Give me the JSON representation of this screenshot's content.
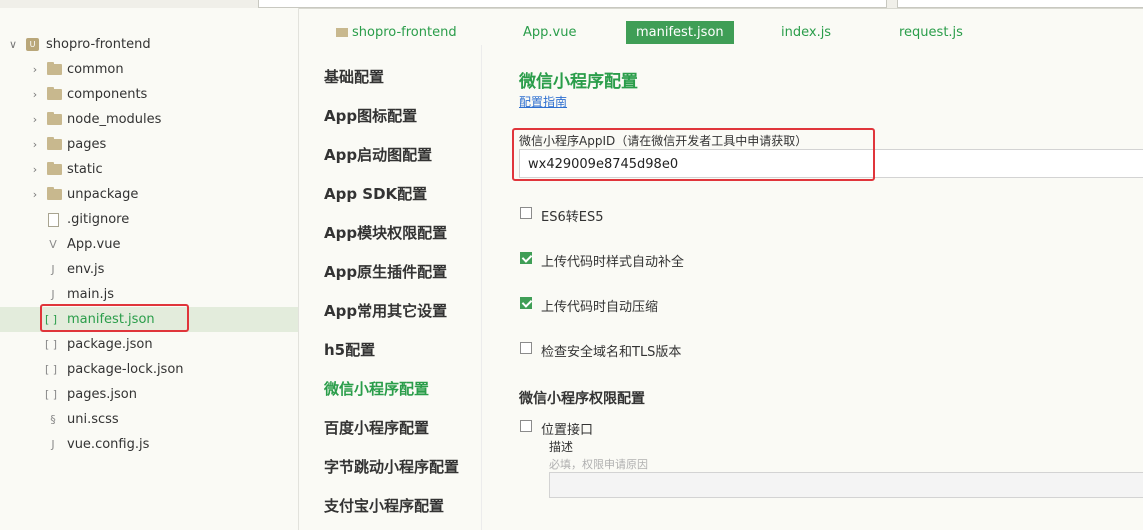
{
  "tree": {
    "project": "shopro-frontend",
    "items": [
      {
        "label": "common",
        "type": "folder"
      },
      {
        "label": "components",
        "type": "folder"
      },
      {
        "label": "node_modules",
        "type": "folder"
      },
      {
        "label": "pages",
        "type": "folder"
      },
      {
        "label": "static",
        "type": "folder"
      },
      {
        "label": "unpackage",
        "type": "folder"
      },
      {
        "label": ".gitignore",
        "type": "file"
      },
      {
        "label": "App.vue",
        "type": "vue"
      },
      {
        "label": "env.js",
        "type": "js"
      },
      {
        "label": "main.js",
        "type": "js"
      },
      {
        "label": "manifest.json",
        "type": "json"
      },
      {
        "label": "package.json",
        "type": "json"
      },
      {
        "label": "package-lock.json",
        "type": "json"
      },
      {
        "label": "pages.json",
        "type": "json"
      },
      {
        "label": "uni.scss",
        "type": "scss"
      },
      {
        "label": "vue.config.js",
        "type": "js"
      }
    ]
  },
  "tabs": [
    "shopro-frontend",
    "App.vue",
    "manifest.json",
    "index.js",
    "request.js"
  ],
  "menu": [
    "基础配置",
    "App图标配置",
    "App启动图配置",
    "App SDK配置",
    "App模块权限配置",
    "App原生插件配置",
    "App常用其它设置",
    "h5配置",
    "微信小程序配置",
    "百度小程序配置",
    "字节跳动小程序配置",
    "支付宝小程序配置"
  ],
  "content": {
    "title": "微信小程序配置",
    "guide_link": "配置指南",
    "appid_label": "微信小程序AppID（请在微信开发者工具中申请获取）",
    "appid_value": "wx429009e8745d98e0",
    "options": [
      {
        "label": "ES6转ES5",
        "checked": false
      },
      {
        "label": "上传代码时样式自动补全",
        "checked": true
      },
      {
        "label": "上传代码时自动压缩",
        "checked": true
      },
      {
        "label": "检查安全域名和TLS版本",
        "checked": false
      }
    ],
    "permission_title": "微信小程序权限配置",
    "location_label": "位置接口",
    "desc_label": "描述",
    "desc_placeholder": "必填，权限申请原因"
  },
  "colors": {
    "accent": "#3f9e56",
    "highlight": "#e0353b",
    "link": "#2e6fd0"
  }
}
